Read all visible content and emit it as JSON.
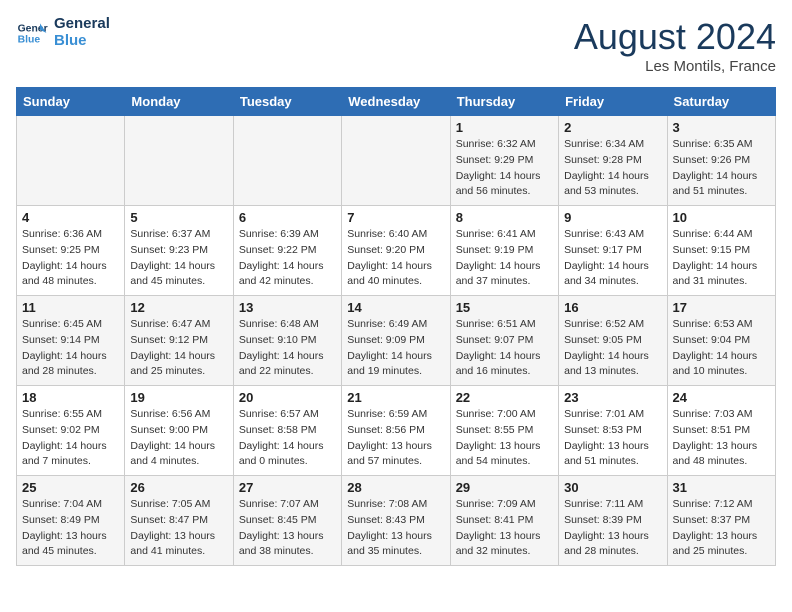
{
  "header": {
    "logo_line1": "General",
    "logo_line2": "Blue",
    "month": "August 2024",
    "location": "Les Montils, France"
  },
  "days_of_week": [
    "Sunday",
    "Monday",
    "Tuesday",
    "Wednesday",
    "Thursday",
    "Friday",
    "Saturday"
  ],
  "weeks": [
    [
      {
        "day": "",
        "info": ""
      },
      {
        "day": "",
        "info": ""
      },
      {
        "day": "",
        "info": ""
      },
      {
        "day": "",
        "info": ""
      },
      {
        "day": "1",
        "info": "Sunrise: 6:32 AM\nSunset: 9:29 PM\nDaylight: 14 hours\nand 56 minutes."
      },
      {
        "day": "2",
        "info": "Sunrise: 6:34 AM\nSunset: 9:28 PM\nDaylight: 14 hours\nand 53 minutes."
      },
      {
        "day": "3",
        "info": "Sunrise: 6:35 AM\nSunset: 9:26 PM\nDaylight: 14 hours\nand 51 minutes."
      }
    ],
    [
      {
        "day": "4",
        "info": "Sunrise: 6:36 AM\nSunset: 9:25 PM\nDaylight: 14 hours\nand 48 minutes."
      },
      {
        "day": "5",
        "info": "Sunrise: 6:37 AM\nSunset: 9:23 PM\nDaylight: 14 hours\nand 45 minutes."
      },
      {
        "day": "6",
        "info": "Sunrise: 6:39 AM\nSunset: 9:22 PM\nDaylight: 14 hours\nand 42 minutes."
      },
      {
        "day": "7",
        "info": "Sunrise: 6:40 AM\nSunset: 9:20 PM\nDaylight: 14 hours\nand 40 minutes."
      },
      {
        "day": "8",
        "info": "Sunrise: 6:41 AM\nSunset: 9:19 PM\nDaylight: 14 hours\nand 37 minutes."
      },
      {
        "day": "9",
        "info": "Sunrise: 6:43 AM\nSunset: 9:17 PM\nDaylight: 14 hours\nand 34 minutes."
      },
      {
        "day": "10",
        "info": "Sunrise: 6:44 AM\nSunset: 9:15 PM\nDaylight: 14 hours\nand 31 minutes."
      }
    ],
    [
      {
        "day": "11",
        "info": "Sunrise: 6:45 AM\nSunset: 9:14 PM\nDaylight: 14 hours\nand 28 minutes."
      },
      {
        "day": "12",
        "info": "Sunrise: 6:47 AM\nSunset: 9:12 PM\nDaylight: 14 hours\nand 25 minutes."
      },
      {
        "day": "13",
        "info": "Sunrise: 6:48 AM\nSunset: 9:10 PM\nDaylight: 14 hours\nand 22 minutes."
      },
      {
        "day": "14",
        "info": "Sunrise: 6:49 AM\nSunset: 9:09 PM\nDaylight: 14 hours\nand 19 minutes."
      },
      {
        "day": "15",
        "info": "Sunrise: 6:51 AM\nSunset: 9:07 PM\nDaylight: 14 hours\nand 16 minutes."
      },
      {
        "day": "16",
        "info": "Sunrise: 6:52 AM\nSunset: 9:05 PM\nDaylight: 14 hours\nand 13 minutes."
      },
      {
        "day": "17",
        "info": "Sunrise: 6:53 AM\nSunset: 9:04 PM\nDaylight: 14 hours\nand 10 minutes."
      }
    ],
    [
      {
        "day": "18",
        "info": "Sunrise: 6:55 AM\nSunset: 9:02 PM\nDaylight: 14 hours\nand 7 minutes."
      },
      {
        "day": "19",
        "info": "Sunrise: 6:56 AM\nSunset: 9:00 PM\nDaylight: 14 hours\nand 4 minutes."
      },
      {
        "day": "20",
        "info": "Sunrise: 6:57 AM\nSunset: 8:58 PM\nDaylight: 14 hours\nand 0 minutes."
      },
      {
        "day": "21",
        "info": "Sunrise: 6:59 AM\nSunset: 8:56 PM\nDaylight: 13 hours\nand 57 minutes."
      },
      {
        "day": "22",
        "info": "Sunrise: 7:00 AM\nSunset: 8:55 PM\nDaylight: 13 hours\nand 54 minutes."
      },
      {
        "day": "23",
        "info": "Sunrise: 7:01 AM\nSunset: 8:53 PM\nDaylight: 13 hours\nand 51 minutes."
      },
      {
        "day": "24",
        "info": "Sunrise: 7:03 AM\nSunset: 8:51 PM\nDaylight: 13 hours\nand 48 minutes."
      }
    ],
    [
      {
        "day": "25",
        "info": "Sunrise: 7:04 AM\nSunset: 8:49 PM\nDaylight: 13 hours\nand 45 minutes."
      },
      {
        "day": "26",
        "info": "Sunrise: 7:05 AM\nSunset: 8:47 PM\nDaylight: 13 hours\nand 41 minutes."
      },
      {
        "day": "27",
        "info": "Sunrise: 7:07 AM\nSunset: 8:45 PM\nDaylight: 13 hours\nand 38 minutes."
      },
      {
        "day": "28",
        "info": "Sunrise: 7:08 AM\nSunset: 8:43 PM\nDaylight: 13 hours\nand 35 minutes."
      },
      {
        "day": "29",
        "info": "Sunrise: 7:09 AM\nSunset: 8:41 PM\nDaylight: 13 hours\nand 32 minutes."
      },
      {
        "day": "30",
        "info": "Sunrise: 7:11 AM\nSunset: 8:39 PM\nDaylight: 13 hours\nand 28 minutes."
      },
      {
        "day": "31",
        "info": "Sunrise: 7:12 AM\nSunset: 8:37 PM\nDaylight: 13 hours\nand 25 minutes."
      }
    ]
  ]
}
